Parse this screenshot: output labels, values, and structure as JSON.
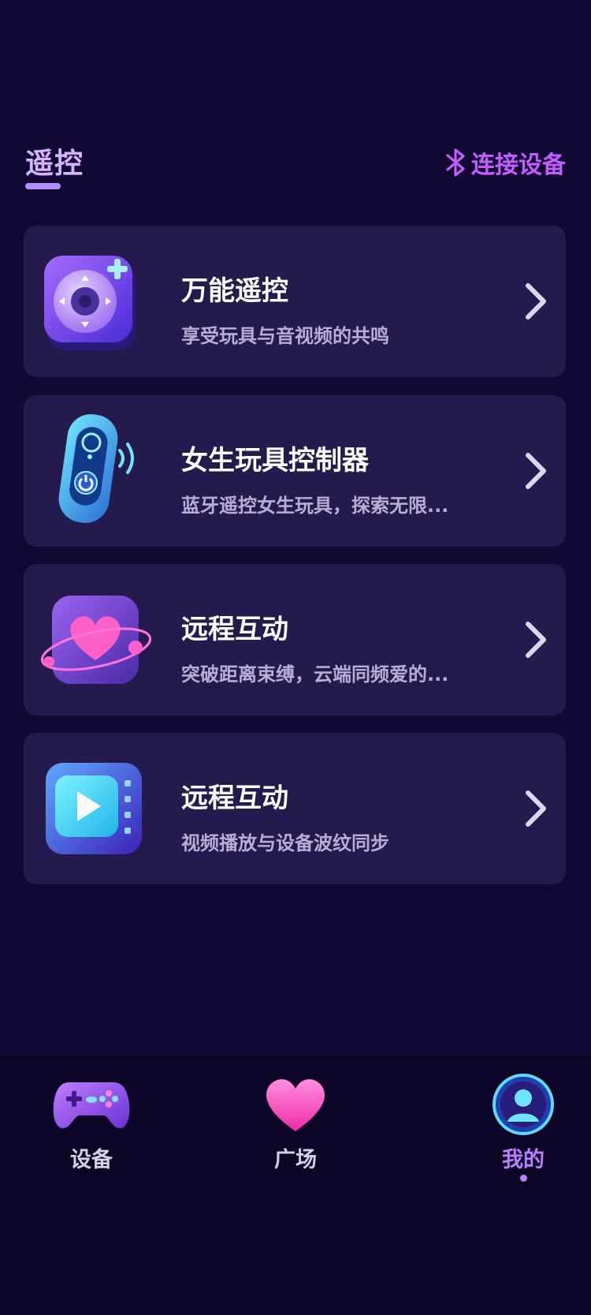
{
  "header": {
    "title": "遥控",
    "connect_label": "连接设备"
  },
  "cards": [
    {
      "title": "万能遥控",
      "desc": "享受玩具与音视频的共鸣",
      "icon": "remote-dpad-icon"
    },
    {
      "title": "女生玩具控制器",
      "desc": "蓝牙遥控女生玩具，探索无限...",
      "icon": "bluetooth-controller-icon"
    },
    {
      "title": "远程互动",
      "desc": "突破距离束缚，云端同频爱的...",
      "icon": "heart-orbit-icon"
    },
    {
      "title": "远程互动",
      "desc": "视频播放与设备波纹同步",
      "icon": "video-play-icon"
    }
  ],
  "tabbar": {
    "items": [
      {
        "label": "设备",
        "icon": "gamepad-icon"
      },
      {
        "label": "广场",
        "icon": "heart-icon"
      },
      {
        "label": "我的",
        "icon": "user-avatar-icon",
        "active": true
      }
    ]
  },
  "colors": {
    "background": "#110833",
    "card": "#241a4d",
    "accent": "#c45cff",
    "title_accent": "#d6b3ff"
  }
}
